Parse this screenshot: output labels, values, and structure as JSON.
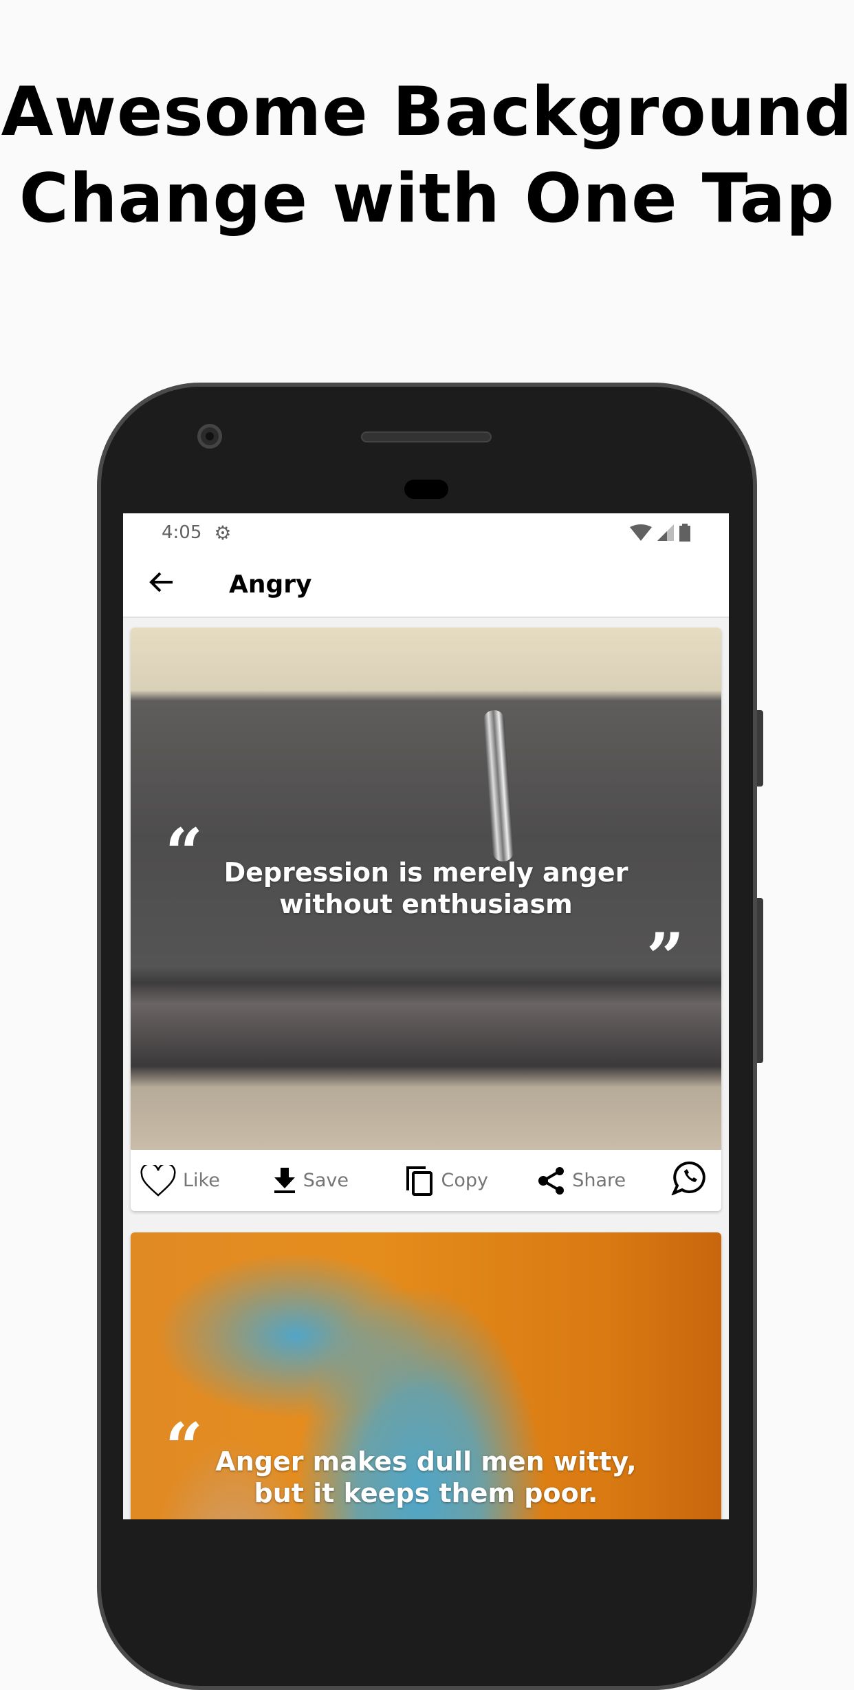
{
  "headline": {
    "line1": "Awesome Background",
    "line2": "Change with One Tap"
  },
  "status_bar": {
    "time": "4:05",
    "icons": [
      "settings-icon",
      "wifi-icon",
      "signal-icon",
      "battery-icon"
    ]
  },
  "app_bar": {
    "title": "Angry",
    "back_icon": "arrow-left-icon"
  },
  "cards": [
    {
      "quote": "Depression is merely anger without enthusiasm",
      "line1": "Depression is merely anger",
      "line2": "without enthusiasm",
      "actions": [
        "Like",
        "Save",
        "Copy",
        "Share"
      ]
    },
    {
      "quote": "Anger makes dull men witty, but it keeps them poor.",
      "line1": "Anger makes dull men witty,",
      "line2": "but it keeps them poor."
    }
  ],
  "quote_marks": {
    "open": "“",
    "close": "”"
  },
  "colors": {
    "background": "#fafafa",
    "phone": "#1c1c1c",
    "text": "#000000",
    "action_text": "#757575"
  }
}
